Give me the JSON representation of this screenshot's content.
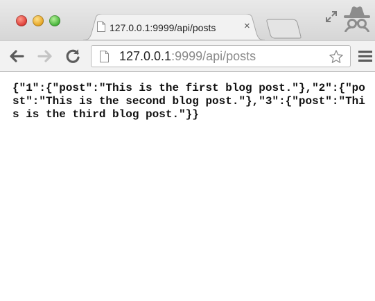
{
  "window": {
    "traffic_lights": [
      "close",
      "minimize",
      "maximize"
    ],
    "colors": {
      "close": "#e0443e",
      "minimize": "#e7a92a",
      "maximize": "#4cb83f"
    }
  },
  "tab": {
    "title": "127.0.0.1:9999/api/posts",
    "close_glyph": "×",
    "favicon": "page-icon"
  },
  "toolbar": {
    "icons": [
      "back-arrow-icon",
      "forward-arrow-icon",
      "reload-icon",
      "star-icon",
      "menu-icon"
    ]
  },
  "address_bar": {
    "host": "127.0.0.1",
    "path": ":9999/api/posts"
  },
  "page": {
    "body_text": "{\"1\":{\"post\":\"This is the first blog post.\"},\"2\":{\"post\":\"This is the second blog post.\"},\"3\":{\"post\":\"This is the third blog post.\"}}"
  }
}
